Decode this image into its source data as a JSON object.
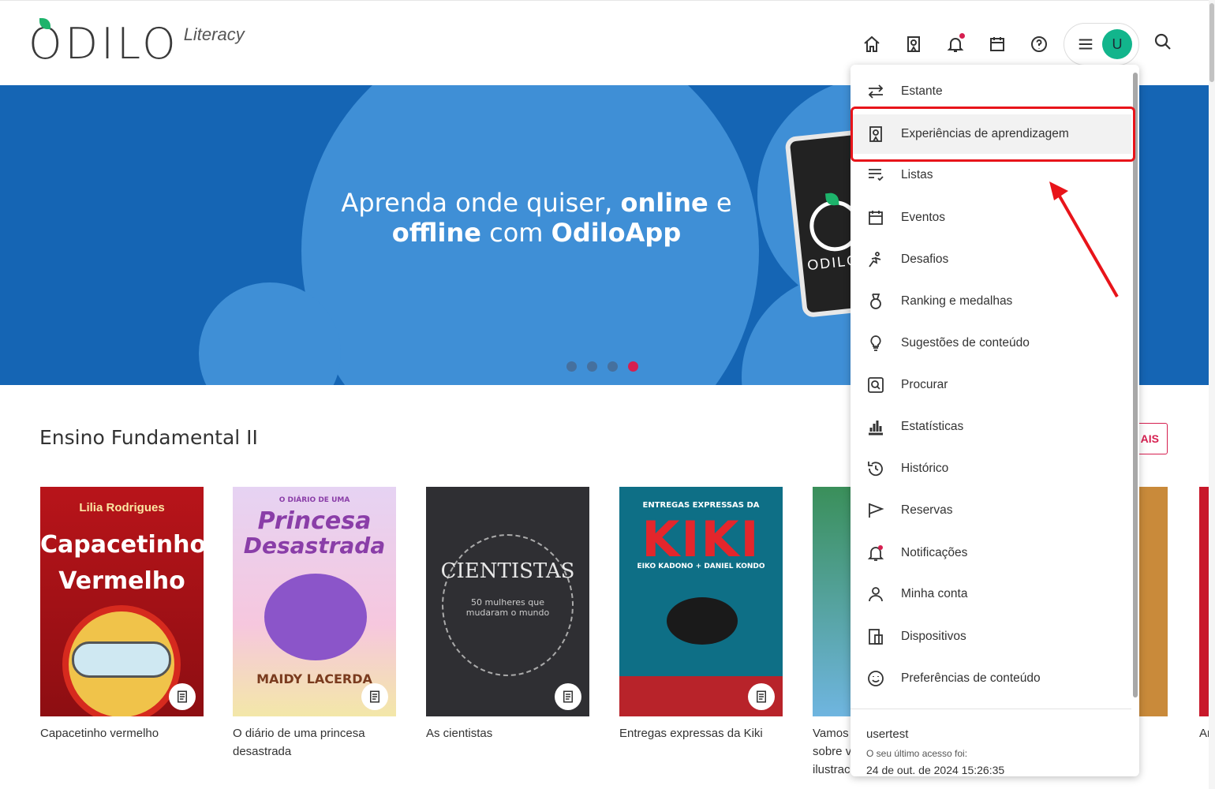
{
  "header": {
    "logo_text": "ODILO",
    "logo_sub": "Literacy",
    "avatar_letter": "U"
  },
  "banner": {
    "line1_regular": "Aprenda onde quiser, ",
    "line1_bold": "online",
    "line1_end": " e",
    "line2_bold": "offline",
    "line2_regular": " com ",
    "line2_brand": "OdiloApp",
    "phone_word": "ODILO",
    "active_dot": 3
  },
  "section": {
    "title": "Ensino Fundamental II",
    "see_all_partial": "AIS"
  },
  "books": [
    {
      "title": "Capacetinho vermelho",
      "cover_author": "Lilia Rodrigues",
      "cover_title_1": "Capacetinho",
      "cover_title_2": "Vermelho"
    },
    {
      "title": "O diário de uma princesa desastrada",
      "cover_top": "O DIÁRIO DE UMA",
      "cover_title_1": "Princesa",
      "cover_title_2": "Desastrada",
      "cover_author": "MAIDY LACERDA"
    },
    {
      "title": "As cientistas",
      "cover_title_1": "CIENTISTAS",
      "cover_sub": "50 mulheres que mudaram o mundo"
    },
    {
      "title": "Entregas expressas da Kiki",
      "cover_top": "ENTREGAS EXPRESSAS DA",
      "cover_title_1": "KIKI",
      "cover_author": "EIKO KADONO + DANIEL KONDO"
    },
    {
      "title": "Vamos sobre v ilustrac"
    },
    {
      "title": "Ar"
    }
  ],
  "menu": {
    "items": [
      {
        "label": "Estante",
        "icon": "swap-icon"
      },
      {
        "label": "Experiências de aprendizagem",
        "icon": "learning-icon"
      },
      {
        "label": "Listas",
        "icon": "list-heart-icon"
      },
      {
        "label": "Eventos",
        "icon": "calendar-icon"
      },
      {
        "label": "Desafios",
        "icon": "challenge-icon"
      },
      {
        "label": "Ranking e medalhas",
        "icon": "medal-icon"
      },
      {
        "label": "Sugestões de conteúdo",
        "icon": "lightbulb-icon"
      },
      {
        "label": "Procurar",
        "icon": "search-box-icon"
      },
      {
        "label": "Estatísticas",
        "icon": "bar-chart-icon"
      },
      {
        "label": "Histórico",
        "icon": "history-icon"
      },
      {
        "label": "Reservas",
        "icon": "flag-icon"
      },
      {
        "label": "Notificações",
        "icon": "bell-icon"
      },
      {
        "label": "Minha conta",
        "icon": "user-icon"
      },
      {
        "label": "Dispositivos",
        "icon": "devices-icon"
      },
      {
        "label": "Preferências de conteúdo",
        "icon": "smiley-icon"
      }
    ],
    "user": "usertest",
    "last_access_label": "O seu último acesso foi:",
    "last_access_date": "24 de out. de 2024 15:26:35"
  },
  "colors": {
    "banner_blue": "#1565b4",
    "accent_red": "#d61f50",
    "avatar_green": "#12b58c",
    "annotation_red": "#e8141a"
  }
}
